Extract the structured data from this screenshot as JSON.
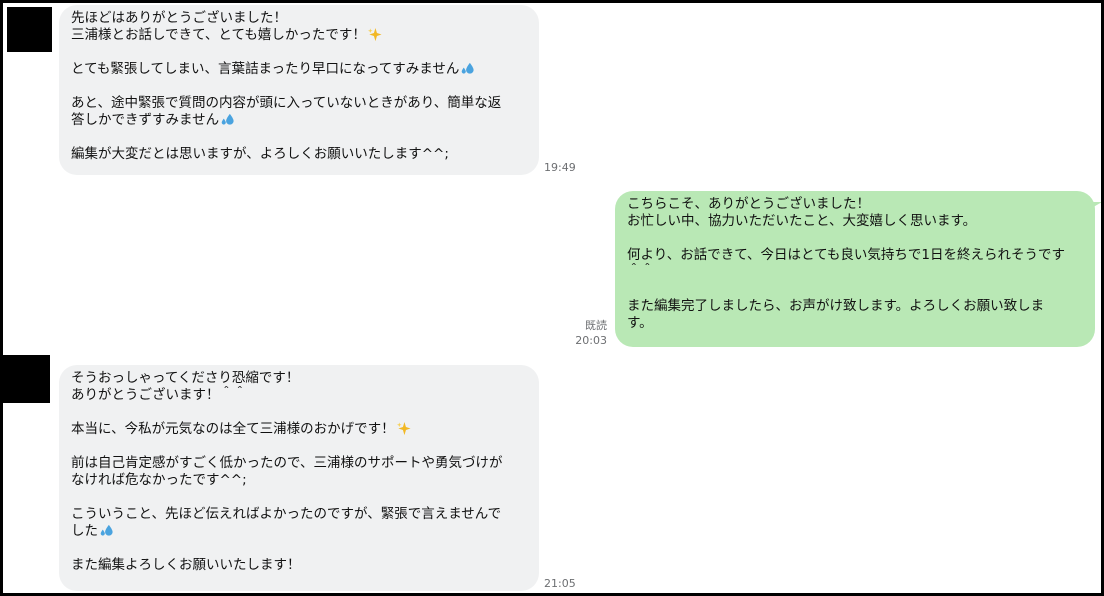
{
  "messages": [
    {
      "side": "in",
      "lines": [
        {
          "text": "先ほどはありがとうございました！"
        },
        {
          "text": "三浦様とお話しできて、とても嬉しかったです！",
          "emoji": "sparkles-icon"
        },
        {
          "text": ""
        },
        {
          "text": "とても緊張してしまい、言葉詰まったり早口になってすみません",
          "emoji": "sweat-drops-icon"
        },
        {
          "text": ""
        },
        {
          "text": "あと、途中緊張で質問の内容が頭に入っていないときがあり、簡単な返"
        },
        {
          "text": "答しかできずすみません",
          "emoji": "sweat-drops-icon"
        },
        {
          "text": ""
        },
        {
          "text": "編集が大変だとは思いますが、よろしくお願いいたします^^;"
        }
      ],
      "time": "19:49"
    },
    {
      "side": "out",
      "lines": [
        {
          "text": "こちらこそ、ありがとうございました！"
        },
        {
          "text": "お忙しい中、協力いただいたこと、大変嬉しく思います。"
        },
        {
          "text": ""
        },
        {
          "text": "何より、お話できて、今日はとても良い気持ちで1日を終えられそうです"
        },
        {
          "text": "＾＾"
        },
        {
          "text": ""
        },
        {
          "text": "また編集完了しましたら、お声がけ致します。よろしくお願い致しま"
        },
        {
          "text": "す。"
        }
      ],
      "read_label": "既読",
      "time": "20:03"
    },
    {
      "side": "in",
      "lines": [
        {
          "text": "そうおっしゃってくださり恐縮です！"
        },
        {
          "text": "ありがとうございます！＾＾"
        },
        {
          "text": ""
        },
        {
          "text": "本当に、今私が元気なのは全て三浦様のおかげです！",
          "emoji": "sparkles-icon"
        },
        {
          "text": ""
        },
        {
          "text": "前は自己肯定感がすごく低かったので、三浦様のサポートや勇気づけが"
        },
        {
          "text": "なければ危なかったです^^;"
        },
        {
          "text": ""
        },
        {
          "text": "こういうこと、先ほど伝えればよかったのですが、緊張で言えませんで"
        },
        {
          "text": "した",
          "emoji": "sweat-drops-icon"
        },
        {
          "text": ""
        },
        {
          "text": "また編集よろしくお願いいたします！"
        }
      ],
      "time": "21:05"
    }
  ],
  "colors": {
    "incoming_bubble": "#f0f1f2",
    "outgoing_bubble": "#b9e8b5",
    "meta_text": "#6d6f72",
    "avatar": "#000000"
  }
}
